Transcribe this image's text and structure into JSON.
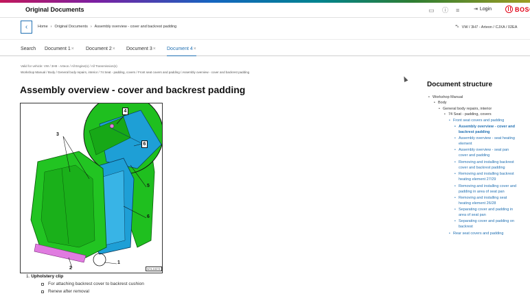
{
  "header": {
    "app_title": "Original Documents",
    "login_label": "Login",
    "brand": "BOSCH"
  },
  "nav": {
    "breadcrumbs": [
      "Home",
      "Original Documents",
      "Assembly overview - cover and backrest padding"
    ],
    "vehicle": "VW / 3H7 - Arteon / CJXA / 02EA"
  },
  "tabs": [
    {
      "label": "Search"
    },
    {
      "label": "Document 1",
      "close": "×"
    },
    {
      "label": "Document 2",
      "close": "×"
    },
    {
      "label": "Document 3",
      "close": "×"
    },
    {
      "label": "Document 4",
      "close": "×",
      "active": true
    }
  ],
  "doc": {
    "valid_for": "Valid for vehicle: VW / 3H8 - Arteon / All Engine(s) / All Transmission(s)",
    "path": "Workshop Manual / Body / General body repairs, interior / 74 Seat - padding, covers / Front seat covers and padding / Assembly overview - cover and backrest padding",
    "title": "Assembly overview - cover and backrest padding",
    "figure": {
      "callouts": [
        "1",
        "2",
        "3",
        "4",
        "5",
        "6",
        "6"
      ],
      "id_label": "N74-10271"
    },
    "legend": {
      "number": "1.",
      "title": "Upholstery clip",
      "items": [
        "For attaching backrest cover to backrest cushion",
        "Renew after removal"
      ]
    }
  },
  "structure": {
    "title": "Document structure",
    "items": [
      {
        "label": "Workshop Manual",
        "style": "plain"
      },
      {
        "label": "Body",
        "style": "plain"
      },
      {
        "label": "General body repairs, interior",
        "style": "plain"
      },
      {
        "label": "74 Seat - padding, covers",
        "style": "plain"
      },
      {
        "label": "Front seat covers and padding",
        "style": "link"
      },
      {
        "label": "Assembly overview - cover and",
        "label2": "backrest padding",
        "style": "active"
      },
      {
        "label": "Assembly overview - seat heating",
        "label2": "element",
        "style": "link"
      },
      {
        "label": "Assembly overview - seat pan",
        "label2": "cover and padding",
        "style": "link"
      },
      {
        "label": "Removing and installing backrest",
        "label2": "cover and backrest padding",
        "style": "link"
      },
      {
        "label": "Removing and installing backrest",
        "label2": "heating element 27/29",
        "style": "link"
      },
      {
        "label": "Removing and installing cover and",
        "label2": "padding in area of seat pan",
        "style": "link"
      },
      {
        "label": "Removing and installing seat",
        "label2": "heating element 26/28",
        "style": "link"
      },
      {
        "label": "Separating cover and padding in",
        "label2": "area of seat pan",
        "style": "link"
      },
      {
        "label": "Separating cover and padding on",
        "label2": "backrest",
        "style": "link"
      },
      {
        "label": "Rear seat covers and padding",
        "style": "link"
      }
    ]
  },
  "colors": {
    "accent": "#1f6fb2",
    "brand_red": "#e20015",
    "part_green": "#1fbf1f",
    "part_blue": "#1e9fd6",
    "part_pink": "#e07be0"
  }
}
